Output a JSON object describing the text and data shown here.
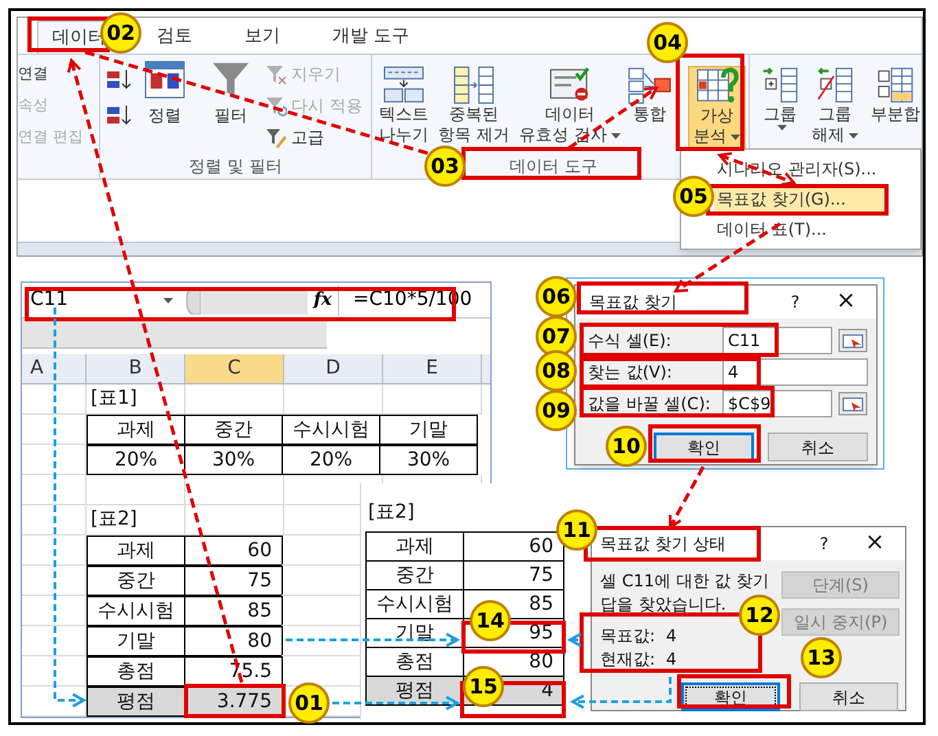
{
  "ribbon": {
    "tabs": [
      {
        "label": "데이터",
        "selected": true
      },
      {
        "label": "검토",
        "selected": false
      },
      {
        "label": "보기",
        "selected": false
      },
      {
        "label": "개발 도구",
        "selected": false
      }
    ],
    "connections": [
      {
        "label": "연결",
        "disabled": false
      },
      {
        "label": "속성",
        "disabled": true
      },
      {
        "label": "연결 편집",
        "disabled": true
      }
    ],
    "sort_filter": {
      "sort": "정렬",
      "filter": "필터",
      "options": [
        {
          "kind": "clear",
          "label": "지우기",
          "disabled": true
        },
        {
          "kind": "reapply",
          "label": "다시 적용",
          "disabled": true
        },
        {
          "kind": "advanced",
          "label": "고급",
          "disabled": false
        }
      ],
      "group_label": "정렬 및 필터"
    },
    "data_tools": {
      "buttons": [
        {
          "kind": "text_to_columns",
          "lines": [
            "텍스트",
            "나누기"
          ],
          "dropdown": false,
          "selected": false
        },
        {
          "kind": "remove_duplicates",
          "lines": [
            "중복된",
            "항목 제거"
          ],
          "dropdown": false,
          "selected": false
        },
        {
          "kind": "validation",
          "lines": [
            "데이터",
            "유효성 검사"
          ],
          "dropdown": true,
          "selected": false
        },
        {
          "kind": "consolidate",
          "lines": [
            "통합"
          ],
          "dropdown": false,
          "selected": false
        },
        {
          "kind": "what_if",
          "lines": [
            "가상",
            "분석"
          ],
          "dropdown": true,
          "selected": true
        }
      ],
      "group_label": "데이터 도구"
    },
    "outline": [
      {
        "kind": "group",
        "lines": [
          "그룹"
        ],
        "dropdown": true
      },
      {
        "kind": "ungroup",
        "lines": [
          "그룹",
          "해제"
        ],
        "dropdown": true
      },
      {
        "kind": "subtotal",
        "lines": [
          "부분합"
        ],
        "dropdown": false
      }
    ],
    "menu": [
      {
        "label": "시나리오 관리자(S)...",
        "selected": false
      },
      {
        "label": "목표값 찾기(G)...",
        "selected": true
      },
      {
        "label": "데이터 표(T)...",
        "selected": false
      }
    ]
  },
  "sheet": {
    "name_box": "C11",
    "function_label": "fx",
    "formula": "=C10*5/100",
    "columns": [
      {
        "label": "A",
        "selected": false
      },
      {
        "label": "B",
        "selected": false
      },
      {
        "label": "C",
        "selected": true
      },
      {
        "label": "D",
        "selected": false
      },
      {
        "label": "E",
        "selected": false
      }
    ],
    "table1": {
      "label": "[표1]",
      "headers": [
        "과제",
        "중간",
        "수시시험",
        "기말"
      ],
      "values": [
        "20%",
        "30%",
        "20%",
        "30%"
      ]
    },
    "table2": {
      "label": "[표2]",
      "rows": [
        {
          "label": "과제",
          "value": "60",
          "highlighted": false
        },
        {
          "label": "중간",
          "value": "75",
          "highlighted": false
        },
        {
          "label": "수시시험",
          "value": "85",
          "highlighted": false
        },
        {
          "label": "기말",
          "value": "80",
          "highlighted": false
        },
        {
          "label": "총점",
          "value": "75.5",
          "highlighted": false
        },
        {
          "label": "평점",
          "value": "3.775",
          "highlighted": true
        }
      ]
    }
  },
  "goal_seek_dialog": {
    "title": "목표값 찾기",
    "help": "?",
    "close": "×",
    "fields": [
      {
        "label": "수식 셀(E):",
        "value": "C11",
        "picker": true
      },
      {
        "label": "찾는 값(V):",
        "value": "4",
        "picker": false
      },
      {
        "label": "값을 바꿀 셀(C):",
        "value": "$C$9",
        "picker": true
      }
    ],
    "buttons": [
      {
        "label": "확인",
        "default": true
      },
      {
        "label": "취소",
        "default": false
      }
    ]
  },
  "result_sheet": {
    "label": "[표2]",
    "rows": [
      {
        "label": "과제",
        "value": "60",
        "highlighted": false
      },
      {
        "label": "중간",
        "value": "75",
        "highlighted": false
      },
      {
        "label": "수시시험",
        "value": "85",
        "highlighted": false
      },
      {
        "label": "기말",
        "value": "95",
        "highlighted": false
      },
      {
        "label": "총점",
        "value": "80",
        "highlighted": false
      },
      {
        "label": "평점",
        "value": "4",
        "highlighted": true
      }
    ]
  },
  "status_dialog": {
    "title": "목표값 찾기 상태",
    "help": "?",
    "close": "×",
    "message": [
      "셀 C11에 대한 값 찾기",
      "답을 찾았습니다."
    ],
    "results": [
      {
        "label": "목표값:",
        "value": "4"
      },
      {
        "label": "현재값:",
        "value": "4"
      }
    ],
    "side_buttons": [
      {
        "label": "단계(S)",
        "disabled": true
      },
      {
        "label": "일시 중지(P)",
        "disabled": true
      }
    ],
    "buttons": [
      {
        "label": "확인",
        "focused": true
      },
      {
        "label": "취소",
        "focused": false
      }
    ]
  },
  "step_badges": [
    "01",
    "02",
    "03",
    "04",
    "05",
    "06",
    "07",
    "08",
    "09",
    "10",
    "11",
    "12",
    "13",
    "14",
    "15"
  ]
}
